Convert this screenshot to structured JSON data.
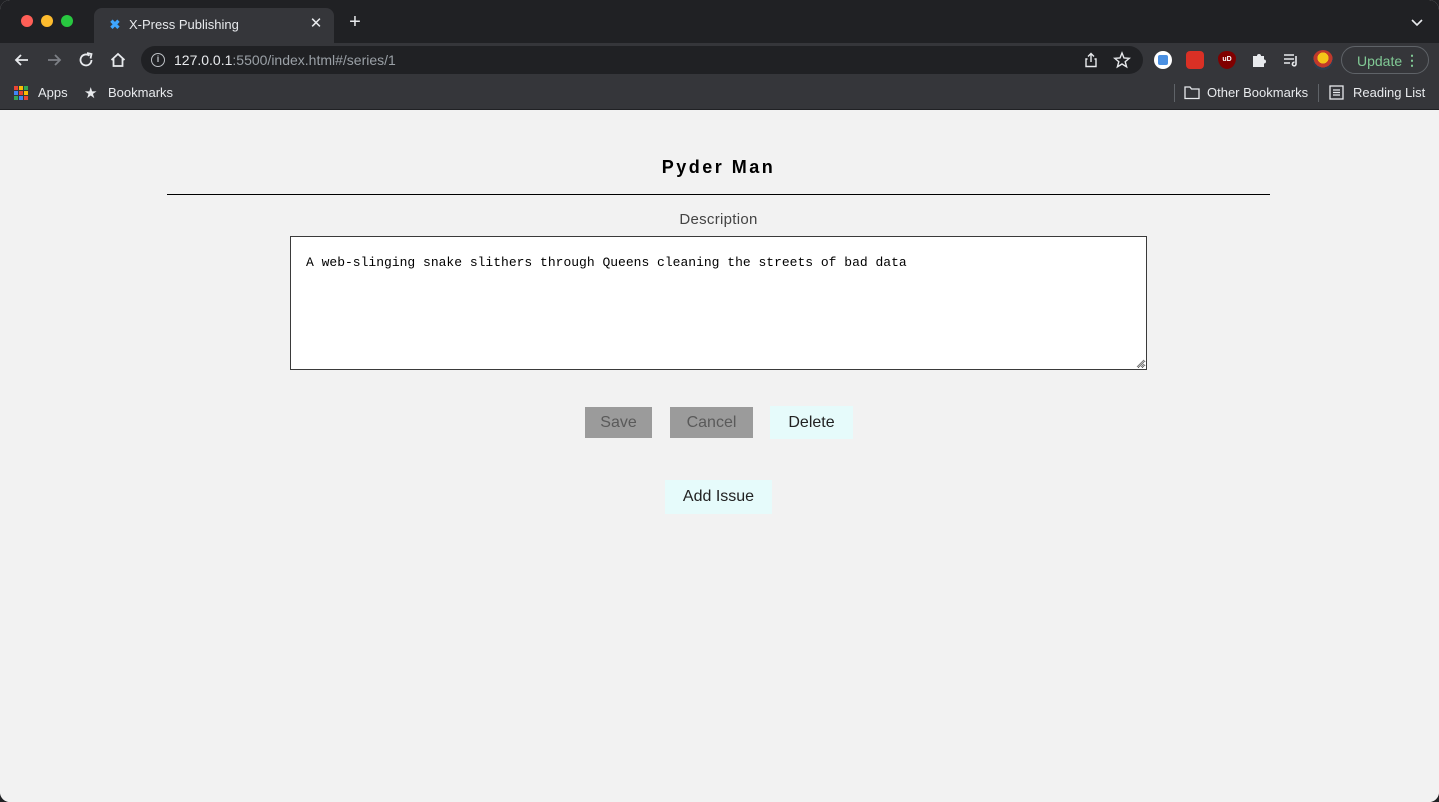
{
  "browser": {
    "tab": {
      "title": "X-Press Publishing",
      "favicon_icon": "x-press-favicon-icon"
    },
    "url": {
      "host": "127.0.0.1",
      "rest": ":5500/index.html#/series/1"
    },
    "update_label": "Update",
    "bookmarks": {
      "apps": "Apps",
      "bookmarks": "Bookmarks",
      "other": "Other Bookmarks",
      "reading_list": "Reading List"
    },
    "extension_badge": "uD"
  },
  "series": {
    "title": "Pyder Man",
    "description_label": "Description",
    "description": "A web-slinging snake slithers through Queens cleaning the streets of bad data"
  },
  "actions": {
    "save": "Save",
    "cancel": "Cancel",
    "delete": "Delete",
    "add_issue": "Add Issue"
  },
  "colors": {
    "page_bg": "#f2f2f2",
    "disabled_button": "#9b9b9b",
    "active_button": "#e6fbfb",
    "chrome_dark": "#202124",
    "chrome_toolbar": "#35363a"
  }
}
